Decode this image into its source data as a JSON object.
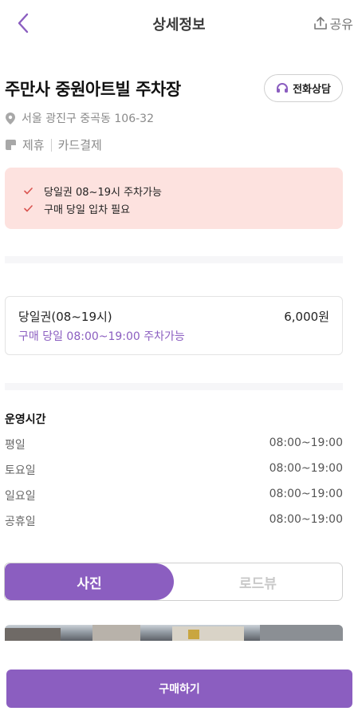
{
  "header": {
    "title": "상세정보",
    "share_label": "공유"
  },
  "place": {
    "name": "주만사 중원아트빌 주차장",
    "call_label": "전화상담",
    "address": "서울 광진구 중곡동 106-32",
    "tags": [
      "제휴",
      "카드결제"
    ]
  },
  "notices": [
    "당일권 08~19시 주차가능",
    "구매 당일 입차 필요"
  ],
  "ticket": {
    "name": "당일권(08~19시)",
    "price": "6,000원",
    "description": "구매 당일 08:00~19:00 주차가능"
  },
  "hours": {
    "title": "운영시간",
    "rows": [
      {
        "day": "평일",
        "time": "08:00~19:00"
      },
      {
        "day": "토요일",
        "time": "08:00~19:00"
      },
      {
        "day": "일요일",
        "time": "08:00~19:00"
      },
      {
        "day": "공휴일",
        "time": "08:00~19:00"
      }
    ]
  },
  "media_toggle": {
    "photo_label": "사진",
    "roadview_label": "로드뷰",
    "selected": "사진"
  },
  "buy_button_label": "구매하기",
  "colors": {
    "accent": "#8b5ec0",
    "notice_bg": "#fde2df",
    "check": "#d9534f"
  },
  "icons": {
    "back": "chevron-left-icon",
    "share": "share-upload-icon",
    "call": "headset-icon",
    "location": "location-pin-icon",
    "tag": "tag-icon",
    "check": "check-icon"
  }
}
